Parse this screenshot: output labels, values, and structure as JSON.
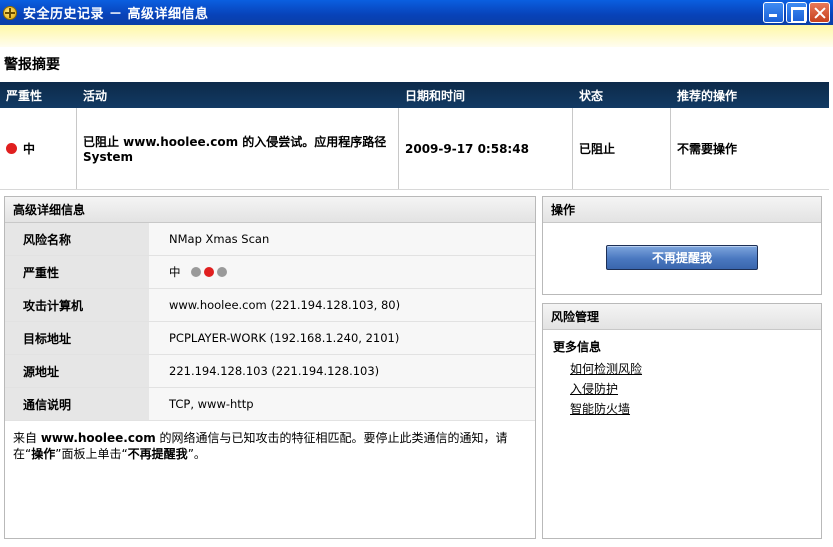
{
  "window": {
    "title": "安全历史记录 － 高级详细信息",
    "title_icon": "shield-globe-icon"
  },
  "summary": {
    "title": "警报摘要",
    "columns": [
      "严重性",
      "活动",
      "日期和时间",
      "状态",
      "推荐的操作"
    ],
    "row": {
      "severity": "中",
      "activity": "已阻止 www.hoolee.com 的入侵尝试。应用程序路径 System",
      "datetime": "2009-9-17 0:58:48",
      "status": "已阻止",
      "recommended": "不需要操作"
    }
  },
  "details": {
    "title": "高级详细信息",
    "rows": [
      {
        "label": "风险名称",
        "value": "NMap Xmas Scan"
      },
      {
        "label": "严重性",
        "value": "中"
      },
      {
        "label": "攻击计算机",
        "value": "www.hoolee.com (221.194.128.103, 80)"
      },
      {
        "label": "目标地址",
        "value": "PCPLAYER-WORK (192.168.1.240, 2101)"
      },
      {
        "label": "源地址",
        "value": "221.194.128.103 (221.194.128.103)"
      },
      {
        "label": "通信说明",
        "value": "TCP, www-http"
      }
    ],
    "severity_level": 2,
    "severity_max": 3,
    "description": {
      "p1": "来自 ",
      "site": "www.hoolee.com",
      "p2": " 的网络通信与已知攻击的特征相匹配。要停止此类通信的通知，请在“",
      "panel": "操作",
      "p3": "”面板上单击“",
      "button": "不再提醒我",
      "p4": "”。"
    }
  },
  "operations": {
    "title": "操作",
    "dismiss_label": "不再提醒我"
  },
  "risk_management": {
    "title": "风险管理",
    "more_info": "更多信息",
    "links": [
      "如何检测风险",
      "入侵防护",
      "智能防火墙"
    ]
  },
  "colors": {
    "severity_red": "#e01f1f",
    "header_navy": "#0d2a4a",
    "title_blue": "#0842b8"
  }
}
